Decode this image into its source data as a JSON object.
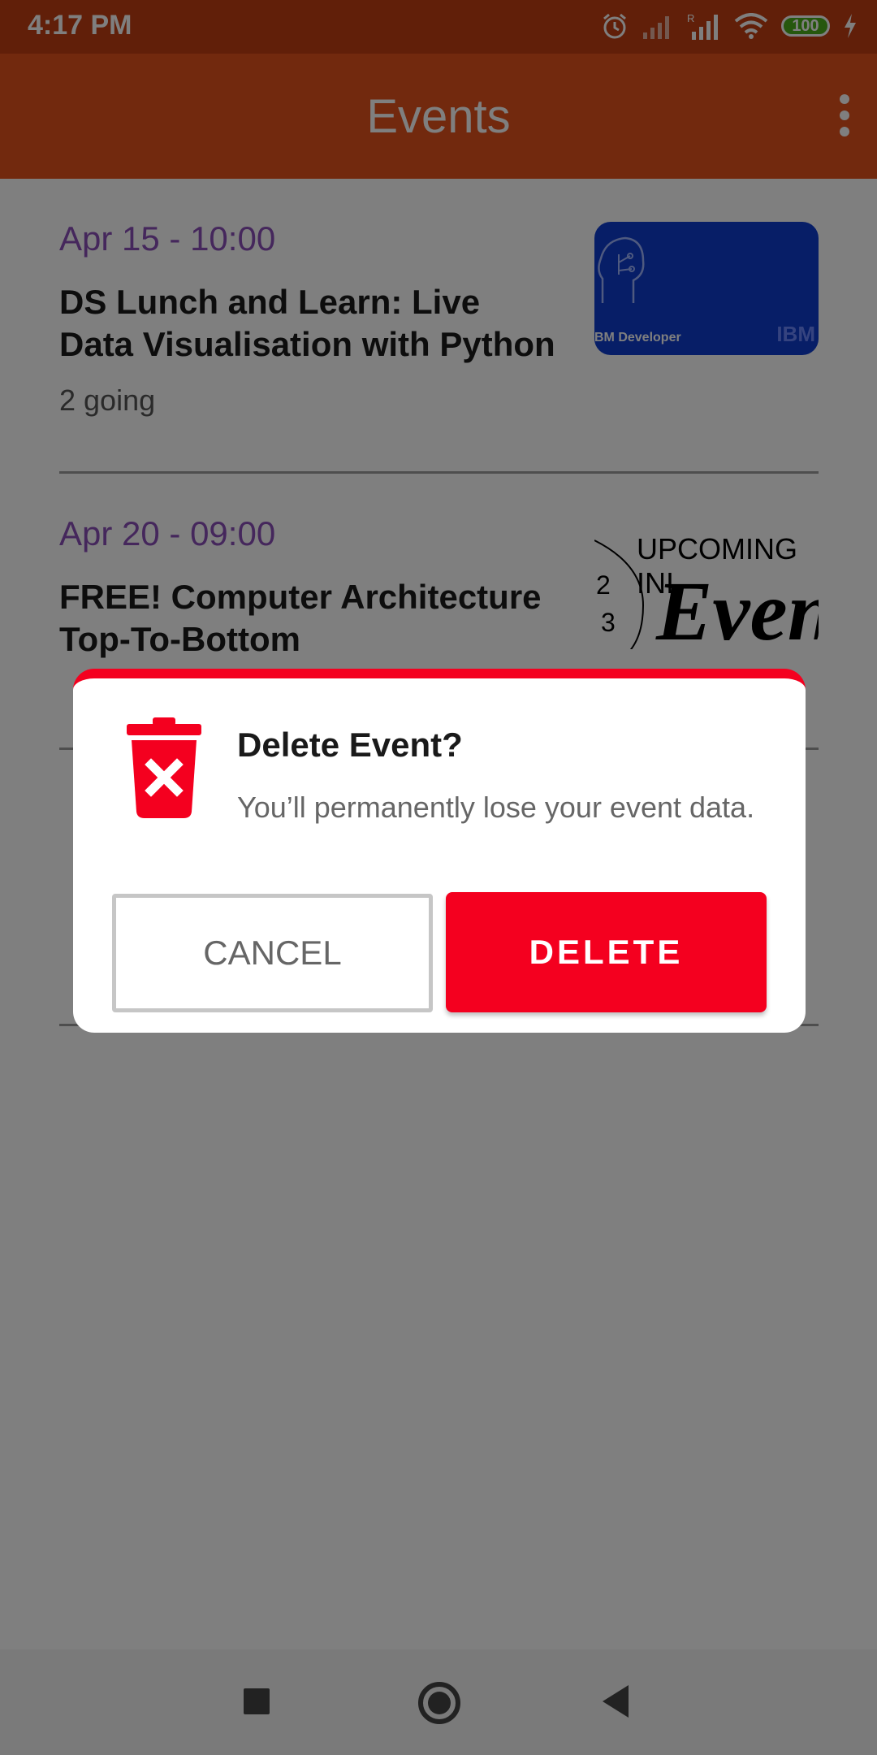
{
  "status_bar": {
    "time": "4:17 PM",
    "battery": "100",
    "icons": [
      "alarm-icon",
      "signal-icon",
      "signal-roaming-icon",
      "wifi-icon",
      "battery-icon",
      "charging-icon"
    ]
  },
  "app_bar": {
    "title": "Events",
    "menu_icon": "overflow-menu-icon"
  },
  "events": [
    {
      "date": "Apr 15 - 10:00",
      "title": "DS Lunch and Learn: Live Data Visualisation with Python",
      "going": "2 going",
      "thumb_label": "BM Developer",
      "thumb_logo": "IBM"
    },
    {
      "date": "Apr 20 - 09:00",
      "title": "FREE! Computer Architecture Top-To-Bottom",
      "thumb_text_top": "UPCOMING INI",
      "thumb_text_big": "Even"
    }
  ],
  "dialog": {
    "title": "Delete Event?",
    "message": "You’ll permanently lose your event data.",
    "cancel_label": "CANCEL",
    "delete_label": "DELETE",
    "icon": "trash-delete-icon",
    "accent_color": "#f4001f"
  },
  "colors": {
    "status_bar": "#c23f12",
    "app_bar": "#e4521d",
    "date_text": "#8a4fb8"
  }
}
